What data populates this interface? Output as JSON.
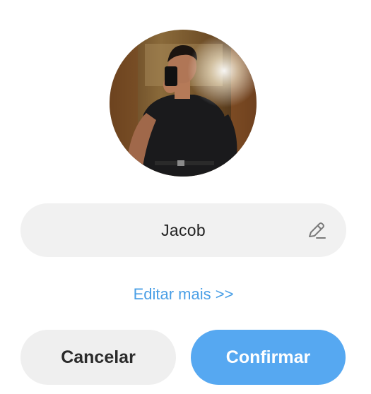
{
  "profile": {
    "avatar_alt": "Profile photo of a man taking a mirror selfie"
  },
  "name_field": {
    "value": "Jacob"
  },
  "edit_more_label": "Editar mais >>",
  "buttons": {
    "cancel_label": "Cancelar",
    "confirm_label": "Confirmar"
  },
  "colors": {
    "accent": "#56a8f1",
    "link": "#4a9fe6",
    "field_background": "#f1f1f1",
    "cancel_background": "#efefef"
  },
  "icons": {
    "edit": "pencil-icon"
  }
}
